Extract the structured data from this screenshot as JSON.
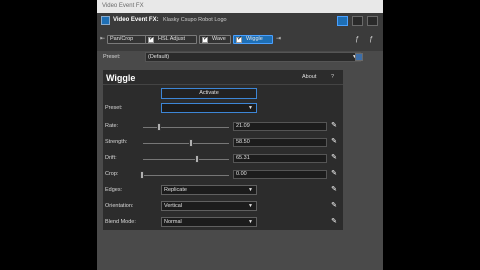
{
  "window": {
    "title": "Video Event FX"
  },
  "header": {
    "title": "Video Event FX:",
    "subtitle": "Klasky Csupo Robot Logo",
    "chain": [
      {
        "label": "Pan/Crop",
        "checked": false,
        "selected": false
      },
      {
        "label": "HSL Adjust",
        "checked": true,
        "selected": false
      },
      {
        "label": "Wave",
        "checked": true,
        "selected": false
      },
      {
        "label": "Wiggle",
        "checked": true,
        "selected": true
      }
    ],
    "preset_label": "Preset:",
    "preset_value": "(Default)"
  },
  "plugin": {
    "title": "Wiggle",
    "about": "About",
    "help": "?",
    "activate": "Activate",
    "preset_label": "Preset:",
    "preset_value": "",
    "rate": {
      "label": "Rate:",
      "value": "21.09",
      "level": 0.211
    },
    "strength": {
      "label": "Strength:",
      "value": "58.50",
      "level": 0.585
    },
    "drift": {
      "label": "Drift:",
      "value": "65.31",
      "level": 0.653
    },
    "crop": {
      "label": "Crop:",
      "value": "0.00",
      "level": 0.0
    },
    "edges": {
      "label": "Edges:",
      "value": "Replicate"
    },
    "orientation": {
      "label": "Orientation:",
      "value": "Vertical"
    },
    "blend": {
      "label": "Blend Mode:",
      "value": "Normal"
    }
  },
  "colors": {
    "accent": "#1e6fb5",
    "window_bg": "#4a4a4a",
    "panel_bg": "#2c2c2c"
  }
}
